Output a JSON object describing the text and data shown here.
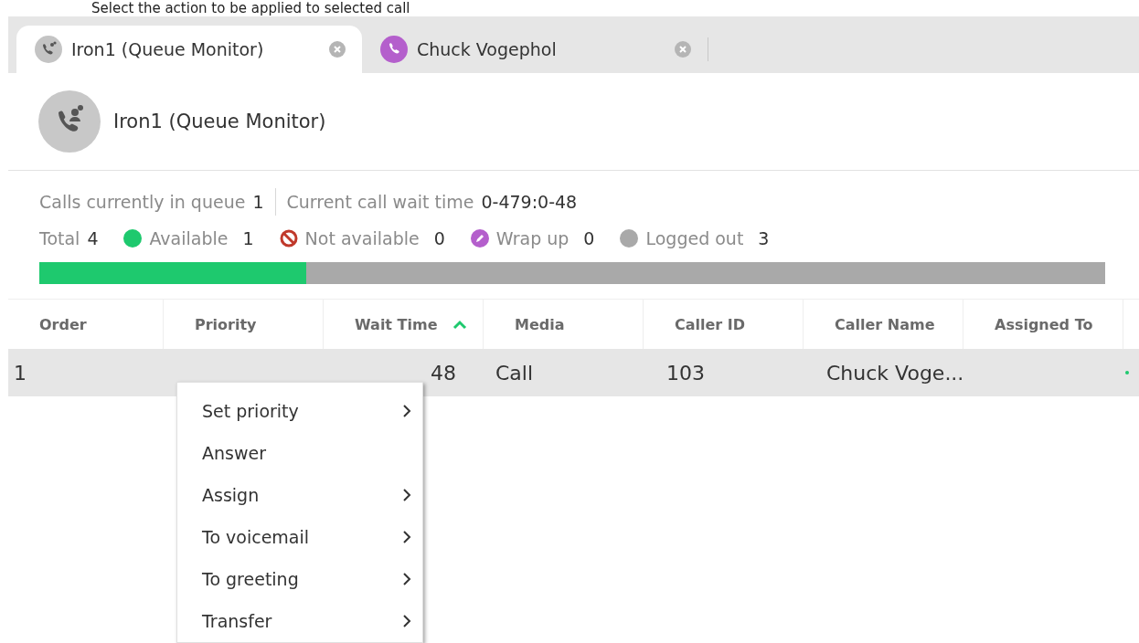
{
  "caption": "Select the action to be applied to selected call",
  "tabs": [
    {
      "label": "Iron1 (Queue Monitor)",
      "kind": "queue",
      "selected": true
    },
    {
      "label": "Chuck Vogephol",
      "kind": "call",
      "selected": false
    }
  ],
  "header": {
    "title": "Iron1 (Queue Monitor)"
  },
  "queue_info": [
    {
      "label": "Calls currently in queue",
      "value": "1"
    },
    {
      "label": "Current call wait time",
      "value": "0-479:0-48"
    }
  ],
  "agents": {
    "total_label": "Total",
    "total": "4",
    "statuses": [
      {
        "kind": "dot",
        "label": "Available",
        "value": "1",
        "color": "#1ec96e"
      },
      {
        "kind": "blocked",
        "label": "Not available",
        "value": "0",
        "color": "#c0392b"
      },
      {
        "kind": "pencil",
        "label": "Wrap up",
        "value": "0",
        "color": "#b45fcc"
      },
      {
        "kind": "dot",
        "label": "Logged out",
        "value": "3",
        "color": "#a9a9a9"
      }
    ],
    "level": 0.25
  },
  "table": {
    "columns": [
      {
        "label": "Order"
      },
      {
        "label": "Priority"
      },
      {
        "label": "Wait Time",
        "sorted": true
      },
      {
        "label": "Media"
      },
      {
        "label": "Caller ID"
      },
      {
        "label": "Caller Name"
      },
      {
        "label": "Assigned To"
      }
    ],
    "rows": [
      {
        "order": "1",
        "wait_time": "48",
        "media": "Call",
        "caller_id": "103",
        "caller_name": "Chuck Voge...",
        "selected": true
      }
    ]
  },
  "context_menu": [
    {
      "label": "Set priority",
      "submenu": true
    },
    {
      "label": "Answer",
      "submenu": false
    },
    {
      "label": "Assign",
      "submenu": true
    },
    {
      "label": "To voicemail",
      "submenu": true
    },
    {
      "label": "To greeting",
      "submenu": true
    },
    {
      "label": "Transfer",
      "submenu": true
    }
  ]
}
